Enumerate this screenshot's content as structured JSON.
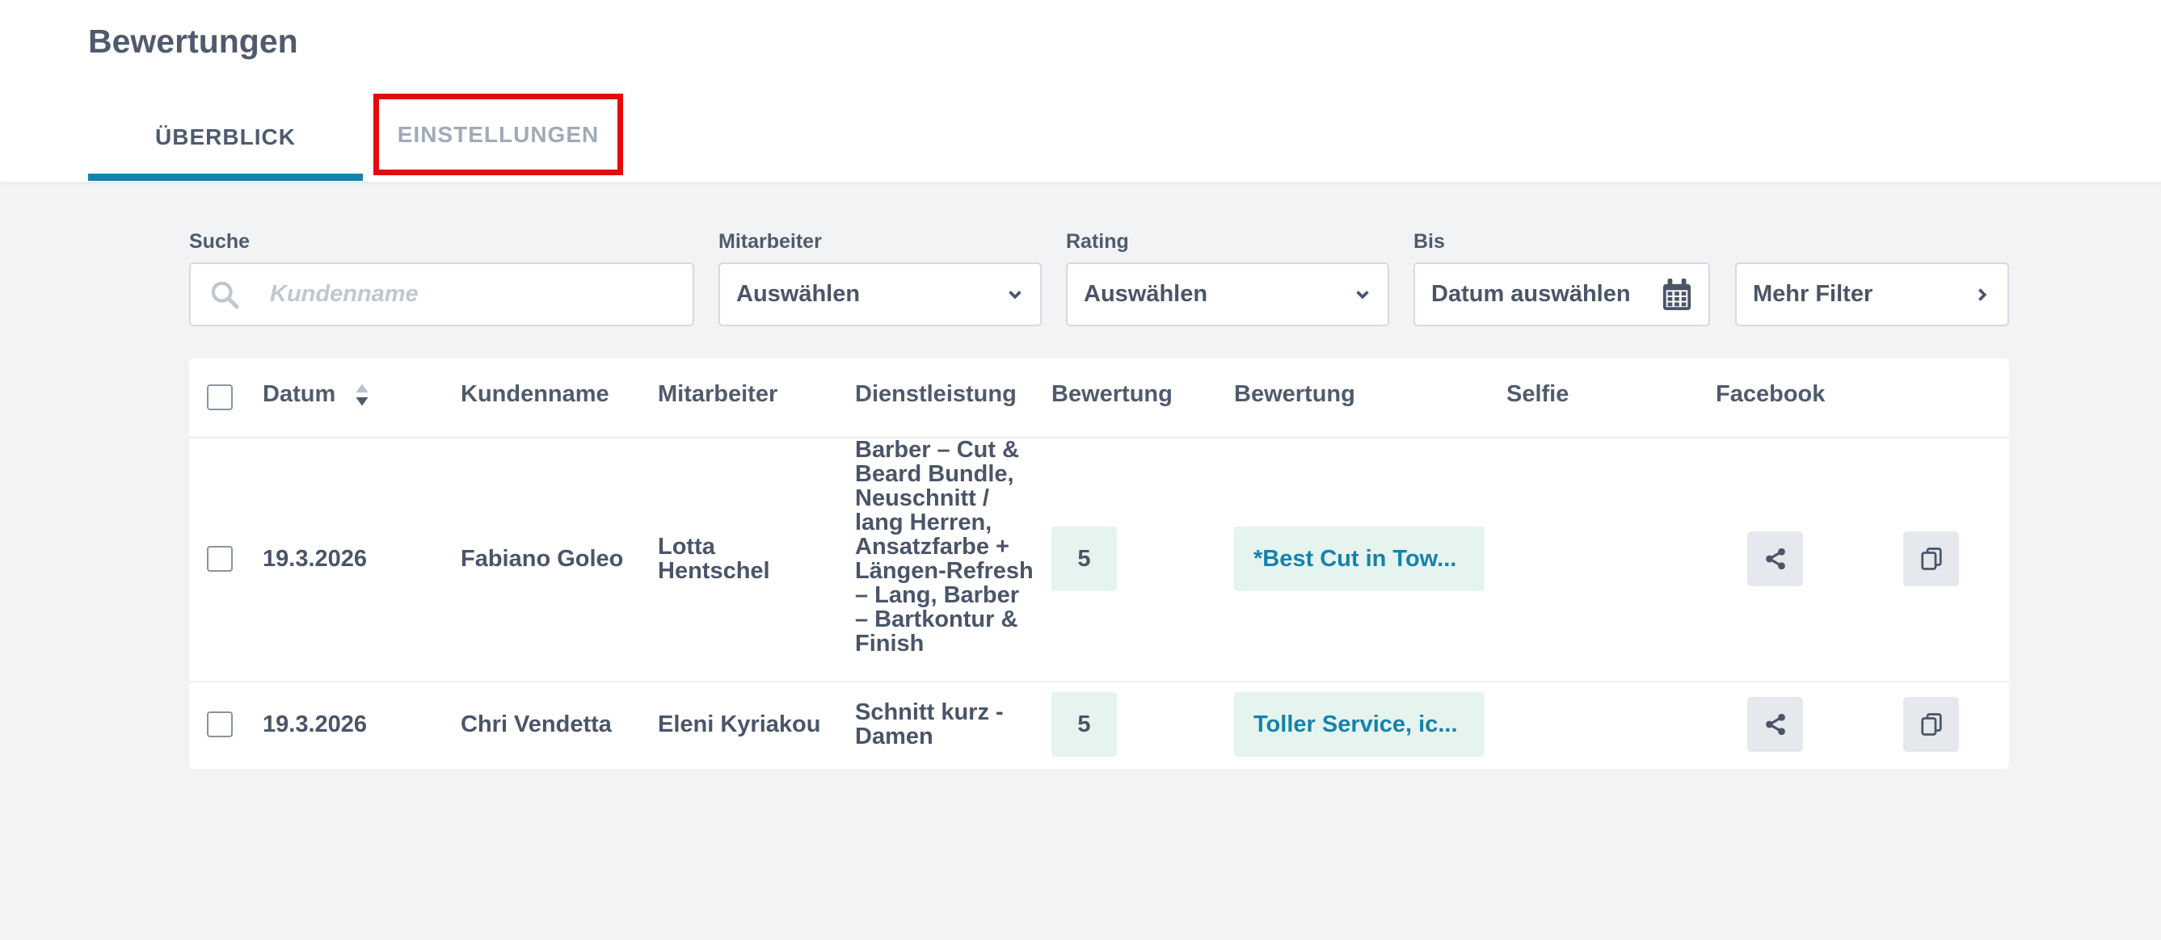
{
  "page": {
    "title": "Bewertungen"
  },
  "tabs": [
    {
      "label": "ÜBERBLICK",
      "active": true
    },
    {
      "label": "EINSTELLUNGEN",
      "active": false
    }
  ],
  "filters": {
    "search": {
      "label": "Suche",
      "placeholder": "Kundenname",
      "value": ""
    },
    "employee": {
      "label": "Mitarbeiter",
      "value": "Auswählen"
    },
    "rating": {
      "label": "Rating",
      "value": "Auswählen"
    },
    "until": {
      "label": "Bis",
      "value": "Datum auswählen"
    },
    "more": {
      "label": "Mehr Filter"
    }
  },
  "table": {
    "headers": [
      "Datum",
      "Kundenname",
      "Mitarbeiter",
      "Dienstleistung",
      "Bewertung",
      "Bewertung",
      "Selfie",
      "Facebook"
    ],
    "rows": [
      {
        "date": "19.3.2026",
        "customer": "Fabiano Goleo",
        "employee": "Lotta Hentschel",
        "service": "Barber – Cut & Beard Bundle, Neuschnitt / lang Herren, Ansatzfarbe + Längen-Refresh – Lang, Barber – Bartkontur & Finish",
        "rating": "5",
        "comment": "*Best Cut in Tow...",
        "selfie": ""
      },
      {
        "date": "19.3.2026",
        "customer": "Chri Vendetta",
        "employee": "Eleni Kyriakou",
        "service": "Schnitt kurz - Damen",
        "rating": "5",
        "comment": "Toller Service, ic...",
        "selfie": ""
      }
    ]
  },
  "colors": {
    "accent": "#1682ab",
    "highlight_border": "#e30b0b",
    "badge_bg": "#e5f4ee",
    "background": "#f2f3f5"
  },
  "icons": {
    "search": "search-icon",
    "dropdown": "chevron-down-icon",
    "calendar": "calendar-icon",
    "more": "chevron-right-icon",
    "sort": "sort-icon",
    "share": "share-icon",
    "copy": "copy-icon"
  }
}
